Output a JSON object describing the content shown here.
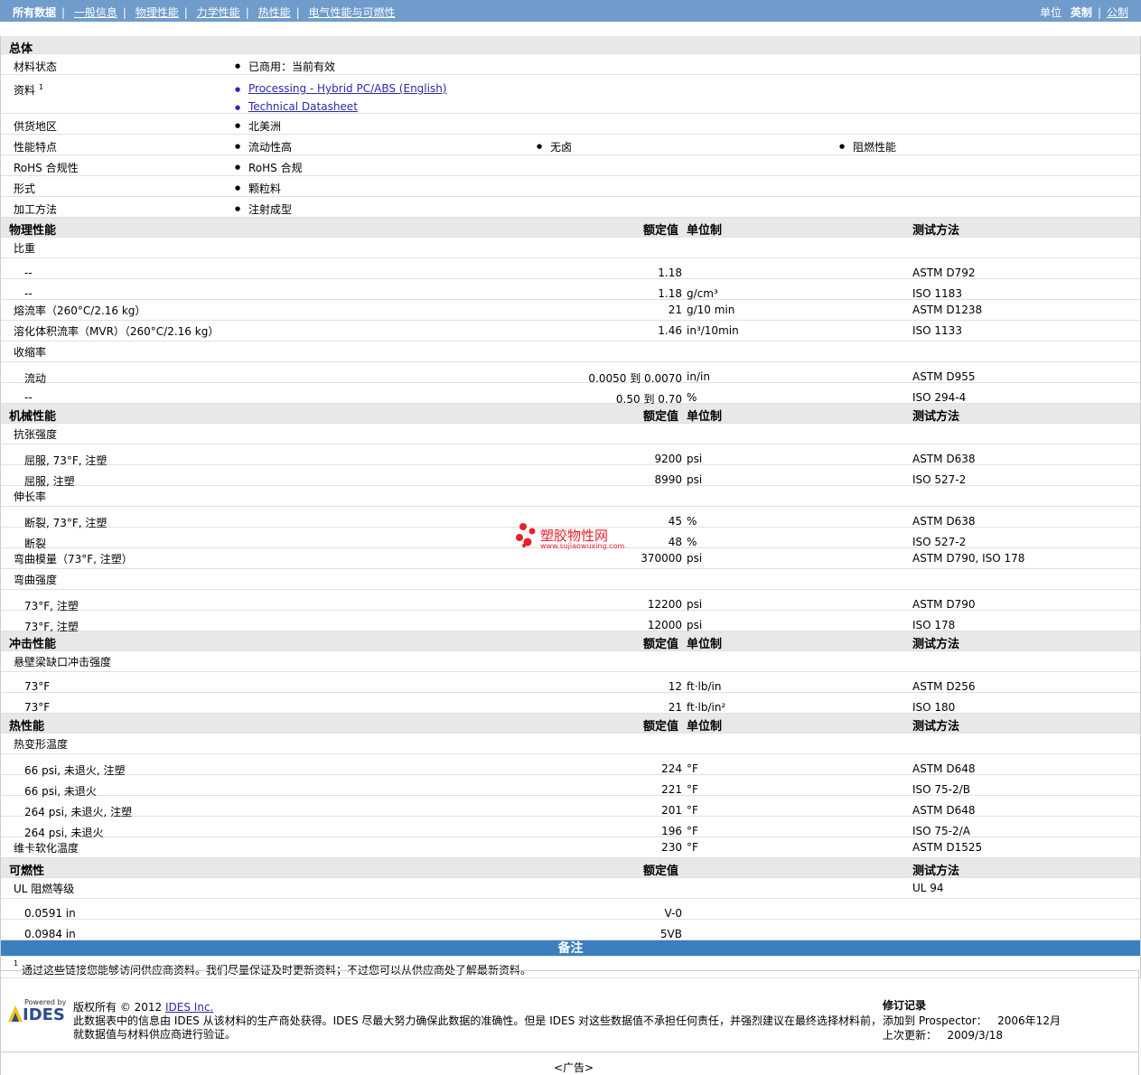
{
  "nav": {
    "items": [
      "所有数据",
      "一般信息",
      "物理性能",
      "力学性能",
      "热性能",
      "电气性能与可燃性"
    ],
    "units_label": "单位",
    "units": [
      "英制",
      "公制"
    ]
  },
  "general": {
    "title": "总体",
    "rows": [
      {
        "label": "材料状态",
        "values": [
          "已商用：当前有效"
        ]
      },
      {
        "label": "资料",
        "sup": "1",
        "links": [
          "Processing - Hybrid PC/ABS (English)",
          "Technical Datasheet"
        ]
      },
      {
        "label": "供货地区",
        "values": [
          "北美洲"
        ]
      },
      {
        "label": "性能特点",
        "values": [
          "流动性高",
          "无卤",
          "阻燃性能"
        ]
      },
      {
        "label": "RoHS 合规性",
        "values": [
          "RoHS 合规"
        ]
      },
      {
        "label": "形式",
        "values": [
          "颗粒料"
        ]
      },
      {
        "label": "加工方法",
        "values": [
          "注射成型"
        ]
      }
    ]
  },
  "headers": {
    "nominal": "额定值",
    "unit": "单位制",
    "method": "测试方法"
  },
  "sections": [
    {
      "title": "物理性能",
      "rows": [
        {
          "name": "比重",
          "level": 0
        },
        {
          "name": "--",
          "level": 1,
          "value": "1.18",
          "unit": "",
          "method": "ASTM D792"
        },
        {
          "name": "--",
          "level": 1,
          "value": "1.18",
          "unit": "g/cm³",
          "method": "ISO 1183"
        },
        {
          "name": "熔流率（260°C/2.16 kg）",
          "level": 0,
          "value": "21",
          "unit": "g/10 min",
          "method": "ASTM D1238"
        },
        {
          "name": "溶化体积流率（MVR）（260°C/2.16 kg）",
          "level": 0,
          "value": "1.46",
          "unit": "in³/10min",
          "method": "ISO 1133"
        },
        {
          "name": "收缩率",
          "level": 0
        },
        {
          "name": "流动",
          "level": 1,
          "value": "0.0050 到  0.0070",
          "unit": "in/in",
          "method": "ASTM D955"
        },
        {
          "name": "--",
          "level": 1,
          "value": "0.50 到  0.70",
          "unit": "%",
          "method": "ISO 294-4"
        }
      ]
    },
    {
      "title": "机械性能",
      "rows": [
        {
          "name": "抗张强度",
          "level": 0
        },
        {
          "name": "屈服, 73°F, 注塑",
          "level": 1,
          "value": "9200",
          "unit": "psi",
          "method": "ASTM D638"
        },
        {
          "name": "屈服, 注塑",
          "level": 1,
          "value": "8990",
          "unit": "psi",
          "method": "ISO 527-2"
        },
        {
          "name": "伸长率",
          "level": 0
        },
        {
          "name": "断裂, 73°F, 注塑",
          "level": 1,
          "value": "45",
          "unit": "%",
          "method": "ASTM D638"
        },
        {
          "name": "断裂",
          "level": 1,
          "value": "48",
          "unit": "%",
          "method": "ISO 527-2"
        },
        {
          "name": "弯曲模量（73°F, 注塑）",
          "level": 0,
          "value": "370000",
          "unit": "psi",
          "method": "ASTM D790, ISO 178"
        },
        {
          "name": "弯曲强度",
          "level": 0
        },
        {
          "name": "73°F, 注塑",
          "level": 1,
          "value": "12200",
          "unit": "psi",
          "method": "ASTM D790"
        },
        {
          "name": "73°F, 注塑",
          "level": 1,
          "value": "12000",
          "unit": "psi",
          "method": "ISO 178"
        }
      ]
    },
    {
      "title": "冲击性能",
      "rows": [
        {
          "name": "悬壁梁缺口冲击强度",
          "level": 0
        },
        {
          "name": "73°F",
          "level": 1,
          "value": "12",
          "unit": "ft·lb/in",
          "method": "ASTM D256"
        },
        {
          "name": "73°F",
          "level": 1,
          "value": "21",
          "unit": "ft·lb/in²",
          "method": "ISO 180"
        }
      ]
    },
    {
      "title": "热性能",
      "rows": [
        {
          "name": "热变形温度",
          "level": 0
        },
        {
          "name": "66 psi, 未退火, 注塑",
          "level": 1,
          "value": "224",
          "unit": "°F",
          "method": "ASTM D648"
        },
        {
          "name": "66 psi, 未退火",
          "level": 1,
          "value": "221",
          "unit": "°F",
          "method": "ISO 75-2/B"
        },
        {
          "name": "264 psi, 未退火, 注塑",
          "level": 1,
          "value": "201",
          "unit": "°F",
          "method": "ASTM D648"
        },
        {
          "name": "264 psi, 未退火",
          "level": 1,
          "value": "196",
          "unit": "°F",
          "method": "ISO 75-2/A"
        },
        {
          "name": "维卡软化温度",
          "level": 0,
          "value": "230",
          "unit": "°F",
          "method": "ASTM D1525"
        }
      ]
    },
    {
      "title": "可燃性",
      "hide_unit": true,
      "rows": [
        {
          "name": "UL 阻燃等级",
          "level": 0,
          "method": "UL 94"
        },
        {
          "name": "0.0591 in",
          "level": 1,
          "value": "V-0"
        },
        {
          "name": "0.0984 in",
          "level": 1,
          "value": "5VB"
        }
      ]
    }
  ],
  "notes": {
    "title": "备注",
    "footnote_num": "1",
    "footnote": "通过这些链接您能够访问供应商资料。我们尽量保证及时更新资料；不过您可以从供应商处了解最新资料。"
  },
  "watermark": {
    "name": "塑胶物性网",
    "url": "www.sujiaowuxing.com"
  },
  "footer": {
    "logo_small": "Powered by",
    "logo": "IDES",
    "copyright": "版权所有 © 2012",
    "company_link": "IDES Inc.",
    "disclaimer_1": "此数据表中的信息由 IDES 从该材料的生产商处获得。IDES 尽最大努力确保此数据的准确性。但是 IDES 对这些数据值不承担任何责任，并强烈建议在最终选择材料前，",
    "disclaimer_2": "就数据值与材料供应商进行验证。",
    "revision_title": "修订记录",
    "added_label": "添加到 Prospector：",
    "added_date": "2006年12月",
    "updated_label": "上次更新：",
    "updated_date": "2009/3/18",
    "ad": "<广告>"
  },
  "colors": {
    "topbar": "#6f9ccb",
    "section_bg": "#e8e8e8",
    "notes_bar": "#3b7fbf",
    "link": "#2a2aa8",
    "watermark_red": "#e8202a"
  }
}
